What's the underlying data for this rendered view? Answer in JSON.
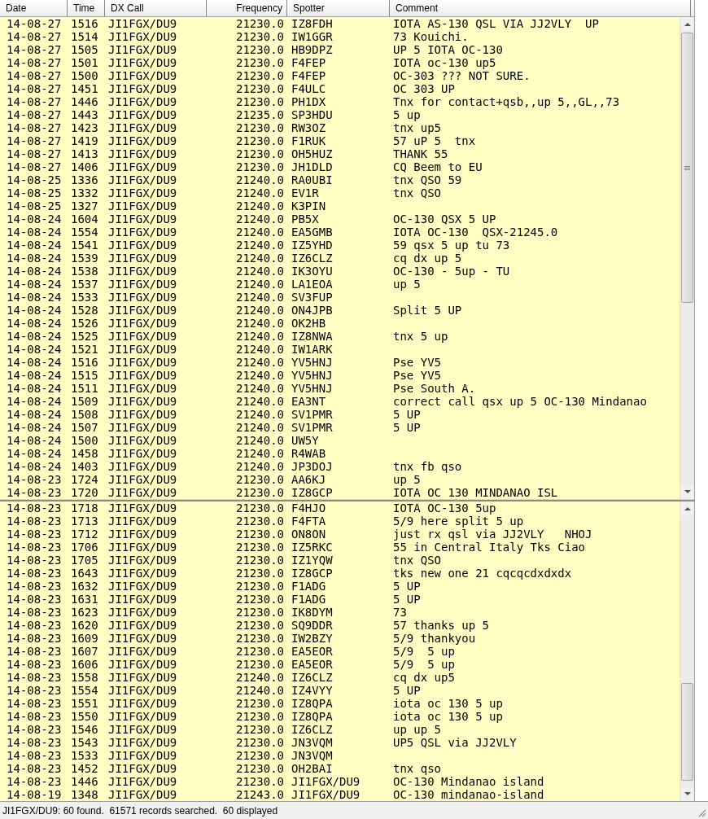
{
  "table": {
    "columns": [
      {
        "label": "Date"
      },
      {
        "label": "Time"
      },
      {
        "label": "DX Call"
      },
      {
        "label": "Frequency"
      },
      {
        "label": "Spotter"
      },
      {
        "label": "Comment"
      }
    ],
    "top_pane": [
      {
        "date": "14-08-27",
        "time": "1516",
        "dx_call": "JI1FGX/DU9",
        "frequency": "21230.0",
        "spotter": "IZ8FDH",
        "comment": "IOTA AS-130 QSL VIA JJ2VLY  UP"
      },
      {
        "date": "14-08-27",
        "time": "1514",
        "dx_call": "JI1FGX/DU9",
        "frequency": "21230.0",
        "spotter": "IW1GGR",
        "comment": "73 Kouichi."
      },
      {
        "date": "14-08-27",
        "time": "1505",
        "dx_call": "JI1FGX/DU9",
        "frequency": "21230.0",
        "spotter": "HB9DPZ",
        "comment": "UP 5 IOTA OC-130"
      },
      {
        "date": "14-08-27",
        "time": "1501",
        "dx_call": "JI1FGX/DU9",
        "frequency": "21230.0",
        "spotter": "F4FEP",
        "comment": "IOTA oc-130 up5"
      },
      {
        "date": "14-08-27",
        "time": "1500",
        "dx_call": "JI1FGX/DU9",
        "frequency": "21230.0",
        "spotter": "F4FEP",
        "comment": "OC-303 ??? NOT SURE."
      },
      {
        "date": "14-08-27",
        "time": "1451",
        "dx_call": "JI1FGX/DU9",
        "frequency": "21230.0",
        "spotter": "F4ULC",
        "comment": "OC 303 UP"
      },
      {
        "date": "14-08-27",
        "time": "1446",
        "dx_call": "JI1FGX/DU9",
        "frequency": "21230.0",
        "spotter": "PH1DX",
        "comment": "Tnx for contact+qsb,,up 5,,GL,,73"
      },
      {
        "date": "14-08-27",
        "time": "1443",
        "dx_call": "JI1FGX/DU9",
        "frequency": "21235.0",
        "spotter": "SP3HDU",
        "comment": "5 up"
      },
      {
        "date": "14-08-27",
        "time": "1423",
        "dx_call": "JI1FGX/DU9",
        "frequency": "21230.0",
        "spotter": "RW3OZ",
        "comment": "tnx up5"
      },
      {
        "date": "14-08-27",
        "time": "1419",
        "dx_call": "JI1FGX/DU9",
        "frequency": "21230.0",
        "spotter": "F1RUK",
        "comment": "57 uP 5  tnx"
      },
      {
        "date": "14-08-27",
        "time": "1413",
        "dx_call": "JI1FGX/DU9",
        "frequency": "21230.0",
        "spotter": "OH5HUZ",
        "comment": "THANK 55"
      },
      {
        "date": "14-08-27",
        "time": "1406",
        "dx_call": "JI1FGX/DU9",
        "frequency": "21230.0",
        "spotter": "JH1DLD",
        "comment": "CQ Beem to EU"
      },
      {
        "date": "14-08-25",
        "time": "1336",
        "dx_call": "JI1FGX/DU9",
        "frequency": "21240.0",
        "spotter": "RA0UBI",
        "comment": "tnx QSO 59"
      },
      {
        "date": "14-08-25",
        "time": "1332",
        "dx_call": "JI1FGX/DU9",
        "frequency": "21240.0",
        "spotter": "EV1R",
        "comment": "tnx QSO"
      },
      {
        "date": "14-08-25",
        "time": "1327",
        "dx_call": "JI1FGX/DU9",
        "frequency": "21240.0",
        "spotter": "K3PIN"
      },
      {
        "date": "14-08-24",
        "time": "1604",
        "dx_call": "JI1FGX/DU9",
        "frequency": "21240.0",
        "spotter": "PB5X",
        "comment": "OC-130 QSX 5 UP"
      },
      {
        "date": "14-08-24",
        "time": "1554",
        "dx_call": "JI1FGX/DU9",
        "frequency": "21240.0",
        "spotter": "EA5GMB",
        "comment": "IOTA OC-130  QSX-21245.0"
      },
      {
        "date": "14-08-24",
        "time": "1541",
        "dx_call": "JI1FGX/DU9",
        "frequency": "21240.0",
        "spotter": "IZ5YHD",
        "comment": "59 qsx 5 up tu 73"
      },
      {
        "date": "14-08-24",
        "time": "1539",
        "dx_call": "JI1FGX/DU9",
        "frequency": "21240.0",
        "spotter": "IZ6CLZ",
        "comment": "cq dx up 5"
      },
      {
        "date": "14-08-24",
        "time": "1538",
        "dx_call": "JI1FGX/DU9",
        "frequency": "21240.0",
        "spotter": "IK3OYU",
        "comment": "OC-130 - 5up - TU"
      },
      {
        "date": "14-08-24",
        "time": "1537",
        "dx_call": "JI1FGX/DU9",
        "frequency": "21240.0",
        "spotter": "LA1EOA",
        "comment": "up 5"
      },
      {
        "date": "14-08-24",
        "time": "1533",
        "dx_call": "JI1FGX/DU9",
        "frequency": "21240.0",
        "spotter": "SV3FUP"
      },
      {
        "date": "14-08-24",
        "time": "1528",
        "dx_call": "JI1FGX/DU9",
        "frequency": "21240.0",
        "spotter": "ON4JPB",
        "comment": "Split 5 UP"
      },
      {
        "date": "14-08-24",
        "time": "1526",
        "dx_call": "JI1FGX/DU9",
        "frequency": "21240.0",
        "spotter": "OK2HB"
      },
      {
        "date": "14-08-24",
        "time": "1525",
        "dx_call": "JI1FGX/DU9",
        "frequency": "21240.0",
        "spotter": "IZ8NWA",
        "comment": "tnx 5 up"
      },
      {
        "date": "14-08-24",
        "time": "1521",
        "dx_call": "JI1FGX/DU9",
        "frequency": "21240.0",
        "spotter": "IW1ARK"
      },
      {
        "date": "14-08-24",
        "time": "1516",
        "dx_call": "JI1FGX/DU9",
        "frequency": "21240.0",
        "spotter": "YV5HNJ",
        "comment": "Pse YV5"
      },
      {
        "date": "14-08-24",
        "time": "1515",
        "dx_call": "JI1FGX/DU9",
        "frequency": "21240.0",
        "spotter": "YV5HNJ",
        "comment": "Pse YV5"
      },
      {
        "date": "14-08-24",
        "time": "1511",
        "dx_call": "JI1FGX/DU9",
        "frequency": "21240.0",
        "spotter": "YV5HNJ",
        "comment": "Pse South A."
      },
      {
        "date": "14-08-24",
        "time": "1509",
        "dx_call": "JI1FGX/DU9",
        "frequency": "21240.0",
        "spotter": "EA3NT",
        "comment": "correct call qsx up 5 OC-130 Mindanao"
      },
      {
        "date": "14-08-24",
        "time": "1508",
        "dx_call": "JI1FGX/DU9",
        "frequency": "21240.0",
        "spotter": "SV1PMR",
        "comment": "5 UP"
      },
      {
        "date": "14-08-24",
        "time": "1507",
        "dx_call": "JI1FGX/DU9",
        "frequency": "21240.0",
        "spotter": "SV1PMR",
        "comment": "5 UP"
      },
      {
        "date": "14-08-24",
        "time": "1500",
        "dx_call": "JI1FGX/DU9",
        "frequency": "21240.0",
        "spotter": "UW5Y"
      },
      {
        "date": "14-08-24",
        "time": "1458",
        "dx_call": "JI1FGX/DU9",
        "frequency": "21240.0",
        "spotter": "R4WAB"
      },
      {
        "date": "14-08-24",
        "time": "1403",
        "dx_call": "JI1FGX/DU9",
        "frequency": "21240.0",
        "spotter": "JP3DOJ",
        "comment": "tnx fb qso"
      },
      {
        "date": "14-08-23",
        "time": "1724",
        "dx_call": "JI1FGX/DU9",
        "frequency": "21230.0",
        "spotter": "AA6KJ",
        "comment": "up 5"
      },
      {
        "date": "14-08-23",
        "time": "1720",
        "dx_call": "JI1FGX/DU9",
        "frequency": "21230.0",
        "spotter": "IZ8GCP",
        "comment": "IOTA OC 130 MINDANAO ISL"
      }
    ],
    "bottom_pane": [
      {
        "date": "14-08-23",
        "time": "1718",
        "dx_call": "JI1FGX/DU9",
        "frequency": "21230.0",
        "spotter": "F4HJO",
        "comment": "IOTA OC-130 5up"
      },
      {
        "date": "14-08-23",
        "time": "1713",
        "dx_call": "JI1FGX/DU9",
        "frequency": "21230.0",
        "spotter": "F4FTA",
        "comment": "5/9 here split 5 up"
      },
      {
        "date": "14-08-23",
        "time": "1712",
        "dx_call": "JI1FGX/DU9",
        "frequency": "21230.0",
        "spotter": "ON8ON",
        "comment": "just rx qsl via JJ2VLY   NHOJ"
      },
      {
        "date": "14-08-23",
        "time": "1706",
        "dx_call": "JI1FGX/DU9",
        "frequency": "21230.0",
        "spotter": "IZ5RKC",
        "comment": "55 in Central Italy Tks Ciao"
      },
      {
        "date": "14-08-23",
        "time": "1705",
        "dx_call": "JI1FGX/DU9",
        "frequency": "21230.0",
        "spotter": "IZ1YQW",
        "comment": "tnx QSO"
      },
      {
        "date": "14-08-23",
        "time": "1643",
        "dx_call": "JI1FGX/DU9",
        "frequency": "21230.0",
        "spotter": "IZ8GCP",
        "comment": "tks new one 21 cqcqcdxdxdx"
      },
      {
        "date": "14-08-23",
        "time": "1632",
        "dx_call": "JI1FGX/DU9",
        "frequency": "21230.0",
        "spotter": "F1ADG",
        "comment": "5 UP"
      },
      {
        "date": "14-08-23",
        "time": "1631",
        "dx_call": "JI1FGX/DU9",
        "frequency": "21230.0",
        "spotter": "F1ADG",
        "comment": "5 UP"
      },
      {
        "date": "14-08-23",
        "time": "1623",
        "dx_call": "JI1FGX/DU9",
        "frequency": "21230.0",
        "spotter": "IK8DYM",
        "comment": "73"
      },
      {
        "date": "14-08-23",
        "time": "1620",
        "dx_call": "JI1FGX/DU9",
        "frequency": "21230.0",
        "spotter": "SQ9DDR",
        "comment": "57 thanks up 5"
      },
      {
        "date": "14-08-23",
        "time": "1609",
        "dx_call": "JI1FGX/DU9",
        "frequency": "21230.0",
        "spotter": "IW2BZY",
        "comment": "5/9 thankyou"
      },
      {
        "date": "14-08-23",
        "time": "1607",
        "dx_call": "JI1FGX/DU9",
        "frequency": "21230.0",
        "spotter": "EA5EOR",
        "comment": "5/9  5 up"
      },
      {
        "date": "14-08-23",
        "time": "1606",
        "dx_call": "JI1FGX/DU9",
        "frequency": "21230.0",
        "spotter": "EA5EOR",
        "comment": "5/9  5 up"
      },
      {
        "date": "14-08-23",
        "time": "1558",
        "dx_call": "JI1FGX/DU9",
        "frequency": "21240.0",
        "spotter": "IZ6CLZ",
        "comment": "cq dx up5"
      },
      {
        "date": "14-08-23",
        "time": "1554",
        "dx_call": "JI1FGX/DU9",
        "frequency": "21240.0",
        "spotter": "IZ4VYY",
        "comment": "5 UP"
      },
      {
        "date": "14-08-23",
        "time": "1551",
        "dx_call": "JI1FGX/DU9",
        "frequency": "21230.0",
        "spotter": "IZ8QPA",
        "comment": "iota oc 130 5 up"
      },
      {
        "date": "14-08-23",
        "time": "1550",
        "dx_call": "JI1FGX/DU9",
        "frequency": "21230.0",
        "spotter": "IZ8QPA",
        "comment": "iota oc 130 5 up"
      },
      {
        "date": "14-08-23",
        "time": "1546",
        "dx_call": "JI1FGX/DU9",
        "frequency": "21230.0",
        "spotter": "IZ6CLZ",
        "comment": "up up 5"
      },
      {
        "date": "14-08-23",
        "time": "1543",
        "dx_call": "JI1FGX/DU9",
        "frequency": "21230.0",
        "spotter": "JN3VQM",
        "comment": "UP5 QSL via JJ2VLY"
      },
      {
        "date": "14-08-23",
        "time": "1533",
        "dx_call": "JI1FGX/DU9",
        "frequency": "21230.0",
        "spotter": "JN3VQM"
      },
      {
        "date": "14-08-23",
        "time": "1452",
        "dx_call": "JI1FGX/DU9",
        "frequency": "21230.0",
        "spotter": "OH2BAI",
        "comment": "tnx qso"
      },
      {
        "date": "14-08-23",
        "time": "1446",
        "dx_call": "JI1FGX/DU9",
        "frequency": "21230.0",
        "spotter": "JI1FGX/DU9",
        "comment": "OC-130 Mindanao island"
      },
      {
        "date": "14-08-19",
        "time": "1348",
        "dx_call": "JI1FGX/DU9",
        "frequency": "21243.0",
        "spotter": "JI1FGX/DU9",
        "comment": "OC-130 mindanao-island"
      }
    ]
  },
  "status_bar": "JI1FGX/DU9: 60 found.  61571 records searched.  60 displayed"
}
